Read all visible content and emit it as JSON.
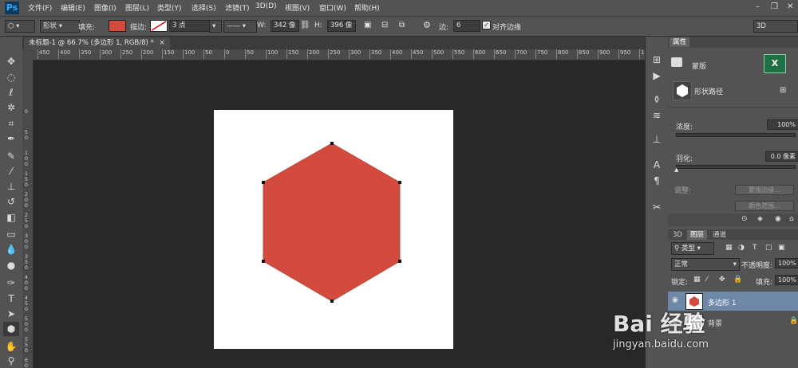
{
  "app": {
    "logo": "Ps"
  },
  "menu": [
    "文件(F)",
    "编辑(E)",
    "图像(I)",
    "图层(L)",
    "类型(Y)",
    "选择(S)",
    "滤镜(T)",
    "3D(D)",
    "视图(V)",
    "窗口(W)",
    "帮助(H)"
  ],
  "window_controls": {
    "minimize": "–",
    "restore": "❐",
    "close": "✕"
  },
  "options": {
    "mode": "形状",
    "fill_label": "填充:",
    "fill_color": "#d24b3e",
    "stroke_label": "描边:",
    "stroke_size": "3 点",
    "w_label": "W:",
    "w_value": "342 像",
    "h_label": "H:",
    "h_value": "396 像",
    "sides_label": "边:",
    "sides_value": "6",
    "align_edges": "对齐边缘",
    "workspace": "3D"
  },
  "document": {
    "tab_title": "未标题-1 @ 66.7% (多边形 1, RGB/8) *",
    "tab_close": "×",
    "shape_color": "#d24b3e",
    "background": "#ffffff"
  },
  "ruler_h": [
    "450",
    "400",
    "350",
    "300",
    "250",
    "200",
    "150",
    "100",
    "50",
    "0",
    "50",
    "100",
    "150",
    "200",
    "250",
    "300",
    "350",
    "400",
    "450",
    "500",
    "550",
    "600",
    "650",
    "700",
    "750",
    "800",
    "850",
    "900",
    "950",
    "1000"
  ],
  "ruler_v": [
    "0",
    "5 0",
    "1 0 0",
    "1 5 0",
    "2 0 0",
    "2 5 0",
    "3 0 0",
    "3 5 0",
    "4 0 0",
    "4 5 0",
    "5 0 0",
    "5 5 0",
    "6 0 0"
  ],
  "tools": [
    "move-icon",
    "marquee-icon",
    "lasso-icon",
    "magic-wand-icon",
    "crop-icon",
    "eyedropper-icon",
    "healing-brush-icon",
    "brush-icon",
    "clone-stamp-icon",
    "history-brush-icon",
    "eraser-icon",
    "gradient-icon",
    "blur-icon",
    "dodge-icon",
    "pen-icon",
    "type-icon",
    "path-select-icon",
    "polygon-icon",
    "hand-icon",
    "zoom-icon"
  ],
  "properties": {
    "tab": "属性",
    "mask_label": "蒙版",
    "shape_path_label": "形状路径",
    "density_label": "浓度:",
    "density_value": "100%",
    "feather_label": "羽化:",
    "feather_value": "0.0 像素",
    "adjust_label": "调整:",
    "mask_edge_button": "蒙版边缘...",
    "color_range_button": "颜色范围..."
  },
  "layers": {
    "tabs": [
      "3D",
      "图层",
      "通道"
    ],
    "filter_kind": "类型",
    "blend_mode": "正常",
    "opacity_label": "不透明度:",
    "opacity_value": "100%",
    "lock_label": "锁定:",
    "fill_label": "填充:",
    "fill_value": "100%",
    "layer1_name": "多边形 1",
    "layer2_name": "背景"
  },
  "watermark": {
    "logo": "Bai 经验",
    "url": "jingyan.baidu.com"
  }
}
